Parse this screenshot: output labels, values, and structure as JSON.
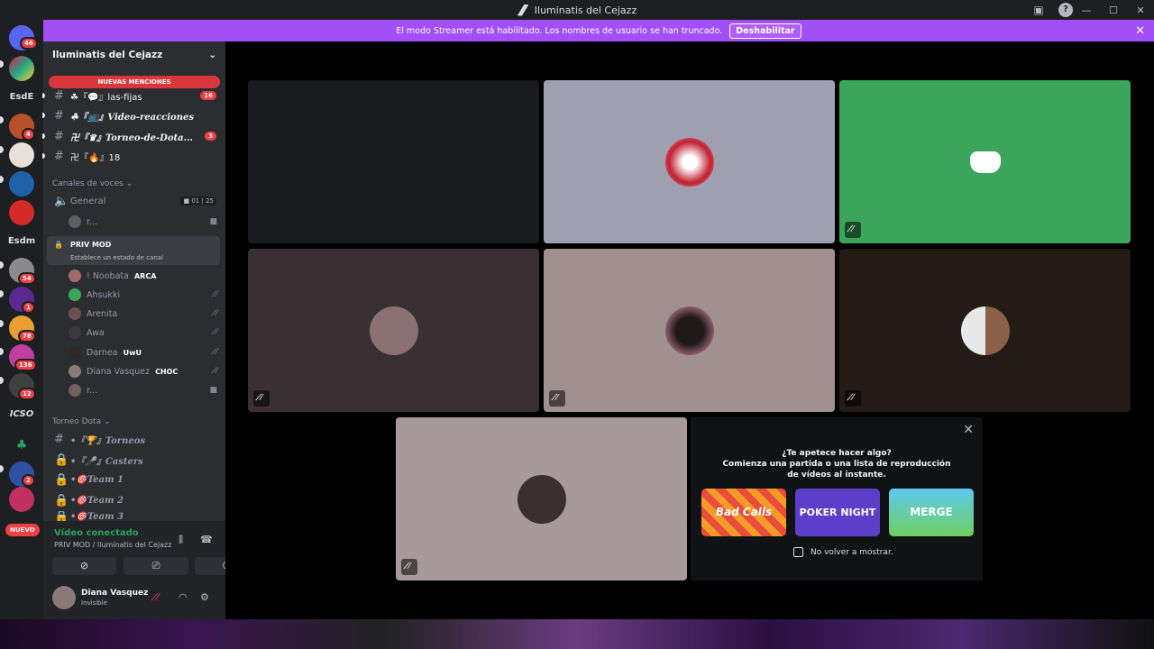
{
  "window": {
    "title": "Iluminatis del Cejazz",
    "controls": [
      "—",
      "☐",
      "✕"
    ]
  },
  "streamer": {
    "message": "El modo Streamer está habilitado. Los nombres de usuario se han truncado.",
    "disable_label": "Deshabilitar"
  },
  "servers": [
    {
      "label": "",
      "badge": "46"
    },
    {
      "label": "",
      "badge": ""
    },
    {
      "label": "EsdE",
      "badge": ""
    },
    {
      "label": "",
      "badge": "4"
    },
    {
      "label": "",
      "badge": ""
    },
    {
      "label": "",
      "badge": ""
    },
    {
      "label": "",
      "badge": ""
    },
    {
      "label": "Esdm",
      "badge": ""
    },
    {
      "label": "",
      "badge": "54"
    },
    {
      "label": "",
      "badge": "1"
    },
    {
      "label": "",
      "badge": "78"
    },
    {
      "label": "",
      "badge": "136"
    },
    {
      "label": "",
      "badge": "12"
    },
    {
      "label": "ICSO",
      "badge": ""
    },
    {
      "label": "",
      "badge": ""
    },
    {
      "label": "",
      "badge": "2"
    },
    {
      "label": "",
      "badge": ""
    }
  ],
  "nuevo_label": "NUEVO",
  "server_name": "Iluminatis del Cejazz",
  "new_mentions": "NUEVAS MENCIONES",
  "text_channels": [
    {
      "icon": "#",
      "name": "☘『💬』las-fijas",
      "count": "16",
      "italic": false
    },
    {
      "icon": "#",
      "name": "☘『📺』Video-reacciones",
      "count": "",
      "italic": true
    },
    {
      "icon": "#",
      "name": "卍『♛』Torneo-de-Dota...",
      "count": "3",
      "italic": true
    },
    {
      "icon": "#",
      "name": "卍『🔥』18",
      "count": "",
      "italic": false
    }
  ],
  "voice_category": "Canales de voces",
  "general_channel": {
    "name": "General",
    "cam": "01",
    "limit": "25"
  },
  "general_member": "r...",
  "priv_mod": {
    "name": "PRIV MOD",
    "status": "Establece un estado de canal"
  },
  "voice_members": [
    {
      "name": "! Noobata",
      "tag": "ARCA"
    },
    {
      "name": "Ahsukki",
      "tag": ""
    },
    {
      "name": "Arenita",
      "tag": ""
    },
    {
      "name": "Awa",
      "tag": ""
    },
    {
      "name": "Darnea",
      "tag": "UwU"
    },
    {
      "name": "Diana Vasquez",
      "tag": "CHOC"
    },
    {
      "name": "r...",
      "tag": ""
    }
  ],
  "dota_category": "Torneo Dota",
  "dota_channels": [
    {
      "icon": "#",
      "name": "•『🏆』Torneos"
    },
    {
      "icon": "🔒",
      "name": "•『🎤』Casters"
    },
    {
      "icon": "🔒",
      "name": "•🎯Team 1"
    },
    {
      "icon": "🔒",
      "name": "•🎯Team 2"
    },
    {
      "icon": "🔒",
      "name": "•🎯Team 3"
    }
  ],
  "voice_panel": {
    "status": "Vídeo conectado",
    "channel": "PRIV MOD / Iluminatis del Cejazz"
  },
  "user": {
    "name": "Diana Vasquez",
    "status": "Invisible"
  },
  "activity": {
    "question": "¿Te apetece hacer algo?",
    "desc": "Comienza una partida o una lista de reproducción de vídeos al instante.",
    "games": [
      "Bad Calls",
      "POKER NIGHT",
      "MERGE"
    ],
    "checkbox": "No volver a mostrar."
  },
  "colors": {
    "accent": "#a34ff8",
    "green": "#3ba55c",
    "red": "#f23f43"
  }
}
